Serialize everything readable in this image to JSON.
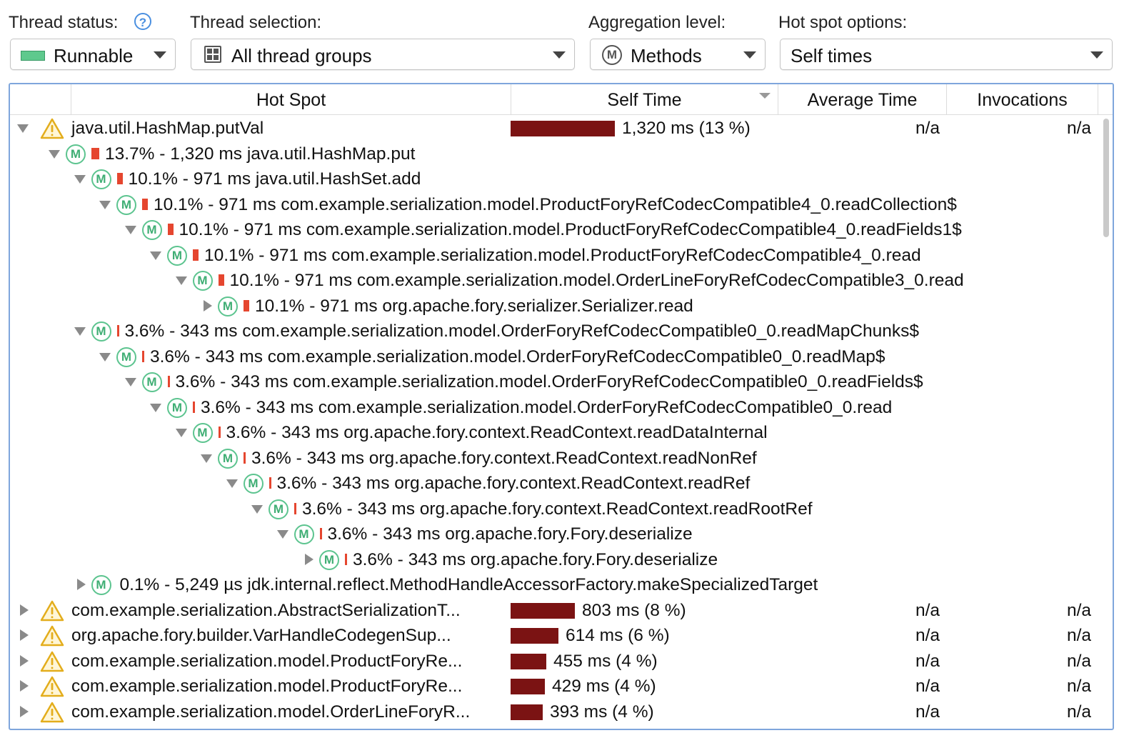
{
  "toolbar": {
    "thread_status": {
      "label": "Thread status:",
      "value": "Runnable",
      "swatch_color": "#5ec98d"
    },
    "help_icon": "?",
    "thread_selection": {
      "label": "Thread selection:",
      "value": "All thread groups"
    },
    "aggregation_level": {
      "label": "Aggregation level:",
      "value": "Methods",
      "icon": "M"
    },
    "hot_spot_options": {
      "label": "Hot spot options:",
      "value": "Self times"
    }
  },
  "table": {
    "columns": [
      "Hot Spot",
      "Self Time",
      "Average Time",
      "Invocations"
    ],
    "sorted_column": "Self Time",
    "bar_color": "#7b1313",
    "mark_color": "#e5462f",
    "method_icon": "M",
    "rows": [
      {
        "kind": "hotspot",
        "expanded": true,
        "name": "java.util.HashMap.putVal",
        "self_time": "1,320 ms (13 %)",
        "self_fraction": 0.13,
        "avg": "n/a",
        "inv": "n/a"
      },
      {
        "kind": "node",
        "depth": 1,
        "expanded": true,
        "text": "13.7% - 1,320 ms java.util.HashMap.put",
        "fraction": 0.137
      },
      {
        "kind": "node",
        "depth": 2,
        "expanded": true,
        "text": "10.1% - 971 ms java.util.HashSet.add",
        "fraction": 0.101
      },
      {
        "kind": "node",
        "depth": 3,
        "expanded": true,
        "text": "10.1% - 971 ms com.example.serialization.model.ProductForyRefCodecCompatible4_0.readCollection$",
        "fraction": 0.101
      },
      {
        "kind": "node",
        "depth": 4,
        "expanded": true,
        "text": "10.1% - 971 ms com.example.serialization.model.ProductForyRefCodecCompatible4_0.readFields1$",
        "fraction": 0.101
      },
      {
        "kind": "node",
        "depth": 5,
        "expanded": true,
        "text": "10.1% - 971 ms com.example.serialization.model.ProductForyRefCodecCompatible4_0.read",
        "fraction": 0.101
      },
      {
        "kind": "node",
        "depth": 6,
        "expanded": true,
        "text": "10.1% - 971 ms com.example.serialization.model.OrderLineForyRefCodecCompatible3_0.read",
        "fraction": 0.101
      },
      {
        "kind": "node",
        "depth": 7,
        "expanded": false,
        "text": "10.1% - 971 ms org.apache.fory.serializer.Serializer.read",
        "fraction": 0.101
      },
      {
        "kind": "node",
        "depth": 2,
        "expanded": true,
        "text": "3.6% - 343 ms com.example.serialization.model.OrderForyRefCodecCompatible0_0.readMapChunks$",
        "fraction": 0.036
      },
      {
        "kind": "node",
        "depth": 3,
        "expanded": true,
        "text": "3.6% - 343 ms com.example.serialization.model.OrderForyRefCodecCompatible0_0.readMap$",
        "fraction": 0.036
      },
      {
        "kind": "node",
        "depth": 4,
        "expanded": true,
        "text": "3.6% - 343 ms com.example.serialization.model.OrderForyRefCodecCompatible0_0.readFields$",
        "fraction": 0.036
      },
      {
        "kind": "node",
        "depth": 5,
        "expanded": true,
        "text": "3.6% - 343 ms com.example.serialization.model.OrderForyRefCodecCompatible0_0.read",
        "fraction": 0.036
      },
      {
        "kind": "node",
        "depth": 6,
        "expanded": true,
        "text": "3.6% - 343 ms org.apache.fory.context.ReadContext.readDataInternal",
        "fraction": 0.036
      },
      {
        "kind": "node",
        "depth": 7,
        "expanded": true,
        "text": "3.6% - 343 ms org.apache.fory.context.ReadContext.readNonRef",
        "fraction": 0.036
      },
      {
        "kind": "node",
        "depth": 8,
        "expanded": true,
        "text": "3.6% - 343 ms org.apache.fory.context.ReadContext.readRef",
        "fraction": 0.036
      },
      {
        "kind": "node",
        "depth": 9,
        "expanded": true,
        "text": "3.6% - 343 ms org.apache.fory.context.ReadContext.readRootRef",
        "fraction": 0.036
      },
      {
        "kind": "node",
        "depth": 10,
        "expanded": true,
        "text": "3.6% - 343 ms org.apache.fory.Fory.deserialize",
        "fraction": 0.036
      },
      {
        "kind": "node",
        "depth": 11,
        "expanded": false,
        "text": "3.6% - 343 ms org.apache.fory.Fory.deserialize",
        "fraction": 0.036
      },
      {
        "kind": "node",
        "depth": 2,
        "expanded": false,
        "text": "0.1% - 5,249 µs jdk.internal.reflect.MethodHandleAccessorFactory.makeSpecializedTarget",
        "fraction": 0.001
      },
      {
        "kind": "hotspot",
        "expanded": false,
        "name": "com.example.serialization.AbstractSerializationT...",
        "self_time": "803 ms (8 %)",
        "self_fraction": 0.08,
        "avg": "n/a",
        "inv": "n/a"
      },
      {
        "kind": "hotspot",
        "expanded": false,
        "name": "org.apache.fory.builder.VarHandleCodegenSup...",
        "self_time": "614 ms (6 %)",
        "self_fraction": 0.06,
        "avg": "n/a",
        "inv": "n/a"
      },
      {
        "kind": "hotspot",
        "expanded": false,
        "name": "com.example.serialization.model.ProductForyRe...",
        "self_time": "455 ms (4 %)",
        "self_fraction": 0.045,
        "avg": "n/a",
        "inv": "n/a"
      },
      {
        "kind": "hotspot",
        "expanded": false,
        "name": "com.example.serialization.model.ProductForyRe...",
        "self_time": "429 ms (4 %)",
        "self_fraction": 0.043,
        "avg": "n/a",
        "inv": "n/a"
      },
      {
        "kind": "hotspot",
        "expanded": false,
        "name": "com.example.serialization.model.OrderLineForyR...",
        "self_time": "393 ms (4 %)",
        "self_fraction": 0.04,
        "avg": "n/a",
        "inv": "n/a"
      }
    ]
  }
}
